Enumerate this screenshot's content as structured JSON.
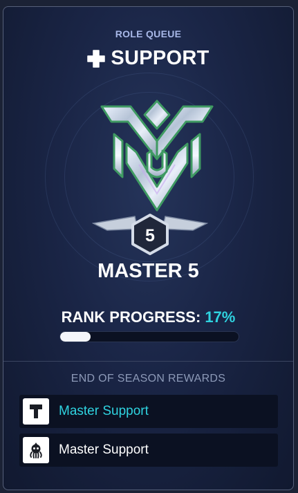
{
  "header": {
    "subtitle": "ROLE QUEUE",
    "role": "SUPPORT",
    "role_icon": "plus-icon"
  },
  "rank": {
    "name": "MASTER 5",
    "tier_number": "5",
    "emblem_icon": "master-rank-emblem",
    "progress_label": "RANK PROGRESS:",
    "progress_text": "17%",
    "progress_fraction": 0.17
  },
  "rewards": {
    "title": "END OF SEASON REWARDS",
    "items": [
      {
        "label": "Master Support",
        "icon": "title-t-icon",
        "color": "#2fd3e0"
      },
      {
        "label": "Master Support",
        "icon": "spray-octopus-icon",
        "color": "#ffffff"
      }
    ]
  },
  "colors": {
    "accent": "#2fd3e0",
    "emblem_green": "#4aa06a",
    "background": "#141d37"
  }
}
